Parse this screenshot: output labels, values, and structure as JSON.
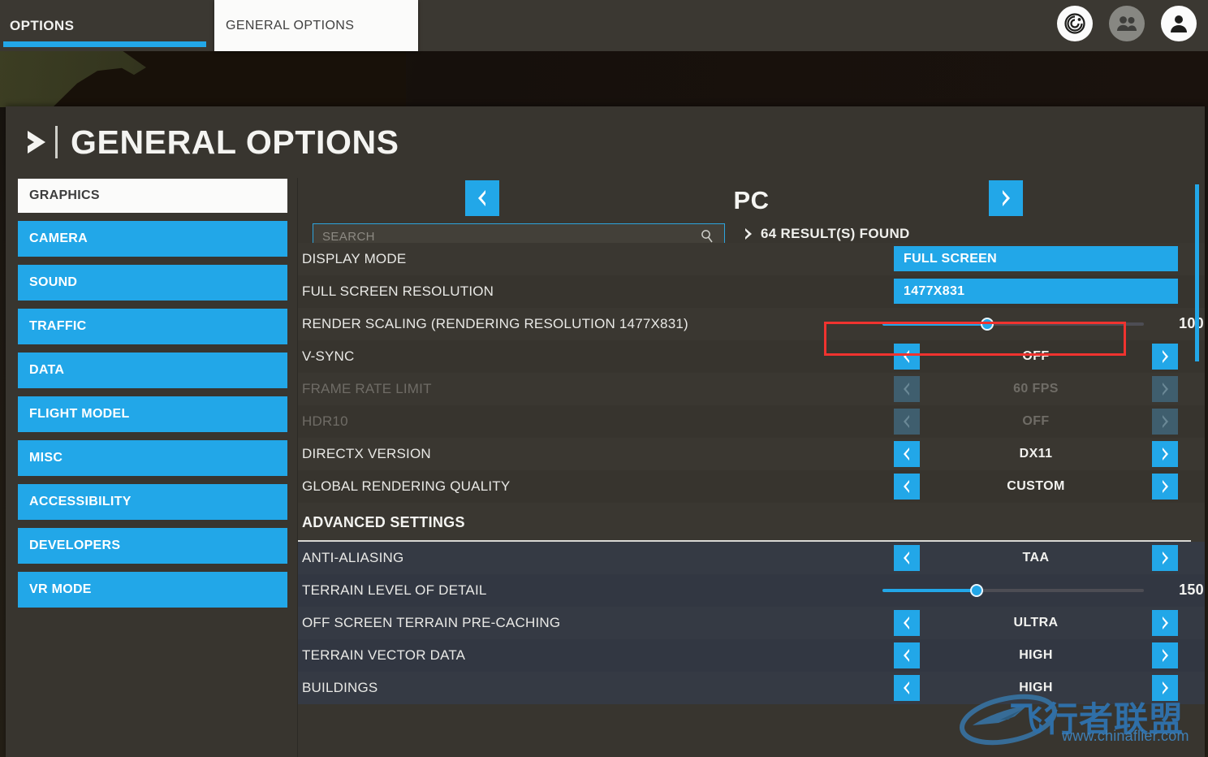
{
  "tabs": {
    "options_label": "OPTIONS",
    "general_label": "GENERAL OPTIONS"
  },
  "top_icons": [
    {
      "name": "radar-icon",
      "title": "Radar"
    },
    {
      "name": "friends-icon",
      "title": "Friends"
    },
    {
      "name": "profile-icon",
      "title": "Profile"
    }
  ],
  "header": {
    "title": "GENERAL OPTIONS"
  },
  "sidebar": {
    "items": [
      {
        "label": "GRAPHICS",
        "selected": true
      },
      {
        "label": "CAMERA",
        "selected": false
      },
      {
        "label": "SOUND",
        "selected": false
      },
      {
        "label": "TRAFFIC",
        "selected": false
      },
      {
        "label": "DATA",
        "selected": false
      },
      {
        "label": "FLIGHT MODEL",
        "selected": false
      },
      {
        "label": "MISC",
        "selected": false
      },
      {
        "label": "ACCESSIBILITY",
        "selected": false
      },
      {
        "label": "DEVELOPERS",
        "selected": false
      },
      {
        "label": "VR MODE",
        "selected": false
      }
    ]
  },
  "content": {
    "platform": "PC",
    "prev_label": "‹",
    "next_label": "›",
    "search": {
      "value": "",
      "placeholder": "SEARCH"
    },
    "results_text": "64 RESULT(S) FOUND",
    "section_title": "ADVANCED SETTINGS",
    "rows": [
      {
        "label": "DISPLAY MODE",
        "type": "dropdown",
        "value": "FULL SCREEN",
        "disabled": false,
        "advanced": false
      },
      {
        "label": "FULL SCREEN RESOLUTION",
        "type": "dropdown",
        "value": "1477X831",
        "disabled": false,
        "advanced": false,
        "highlighted": true
      },
      {
        "label": "RENDER SCALING (RENDERING RESOLUTION 1477X831)",
        "type": "slider",
        "value": "100",
        "fill_pct": 40,
        "disabled": false,
        "advanced": false
      },
      {
        "label": "V-SYNC",
        "type": "spinner",
        "value": "OFF",
        "disabled": false,
        "advanced": false
      },
      {
        "label": "FRAME RATE LIMIT",
        "type": "spinner",
        "value": "60 FPS",
        "disabled": true,
        "advanced": false
      },
      {
        "label": "HDR10",
        "type": "spinner",
        "value": "OFF",
        "disabled": true,
        "advanced": false
      },
      {
        "label": "DIRECTX VERSION",
        "type": "spinner",
        "value": "DX11",
        "disabled": false,
        "advanced": false
      },
      {
        "label": "GLOBAL RENDERING QUALITY",
        "type": "spinner",
        "value": "CUSTOM",
        "disabled": false,
        "advanced": false
      },
      {
        "label": "ANTI-ALIASING",
        "type": "spinner",
        "value": "TAA",
        "disabled": false,
        "advanced": true
      },
      {
        "label": "TERRAIN LEVEL OF DETAIL",
        "type": "slider",
        "value": "150",
        "fill_pct": 36,
        "disabled": false,
        "advanced": true
      },
      {
        "label": "OFF SCREEN TERRAIN PRE-CACHING",
        "type": "spinner",
        "value": "ULTRA",
        "disabled": false,
        "advanced": true
      },
      {
        "label": "TERRAIN VECTOR DATA",
        "type": "spinner",
        "value": "HIGH",
        "disabled": false,
        "advanced": true
      },
      {
        "label": "BUILDINGS",
        "type": "spinner",
        "value": "HIGH",
        "disabled": false,
        "advanced": true
      }
    ]
  },
  "watermark": {
    "cn_text": "飞行者联盟",
    "url_text": "www.chinaflier.com"
  },
  "colors": {
    "accent_blue": "#22a7e8",
    "panel_bg": "#38352f",
    "tabbar_bg": "#3b3832",
    "highlight_red": "#f0332f",
    "advanced_row_bg": "#353a44"
  }
}
